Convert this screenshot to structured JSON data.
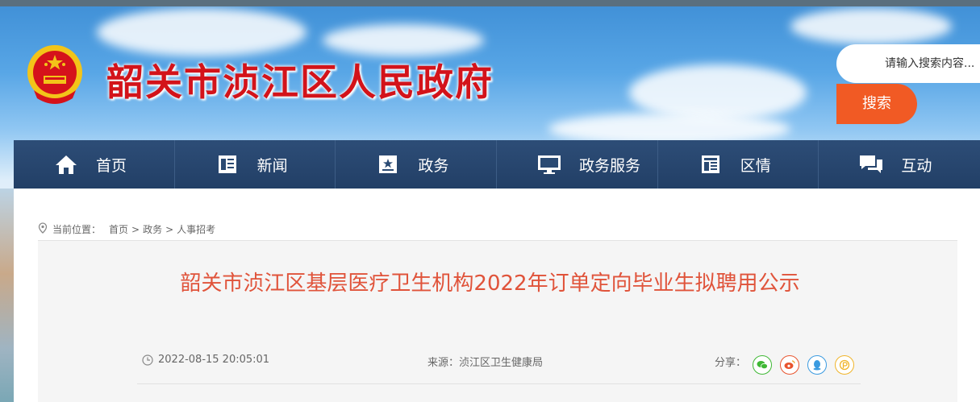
{
  "header": {
    "site_title": "韶关市浈江区人民政府",
    "search_placeholder": "请输入搜索内容...",
    "search_button": "搜索"
  },
  "nav": {
    "items": [
      {
        "label": "首页",
        "icon": "home-icon"
      },
      {
        "label": "新闻",
        "icon": "newspaper-icon"
      },
      {
        "label": "政务",
        "icon": "government-icon"
      },
      {
        "label": "政务服务",
        "icon": "monitor-icon"
      },
      {
        "label": "区情",
        "icon": "document-icon"
      },
      {
        "label": "互动",
        "icon": "chat-icon"
      }
    ]
  },
  "breadcrumb": {
    "prefix": "当前位置：",
    "items": [
      "首页",
      "政务",
      "人事招考"
    ],
    "separator": ">"
  },
  "article": {
    "title": "韶关市浈江区基层医疗卫生机构2022年订单定向毕业生拟聘用公示",
    "datetime": "2022-08-15 20:05:01",
    "source": "来源：浈江区卫生健康局",
    "share_label": "分享：",
    "share_icons": [
      "wechat-icon",
      "weibo-icon",
      "qq-icon",
      "qzone-icon"
    ]
  },
  "colors": {
    "title_red": "#d3131a",
    "search_orange": "#f15a24",
    "nav_bg": "#2d4d77",
    "article_title": "#e0533a"
  }
}
